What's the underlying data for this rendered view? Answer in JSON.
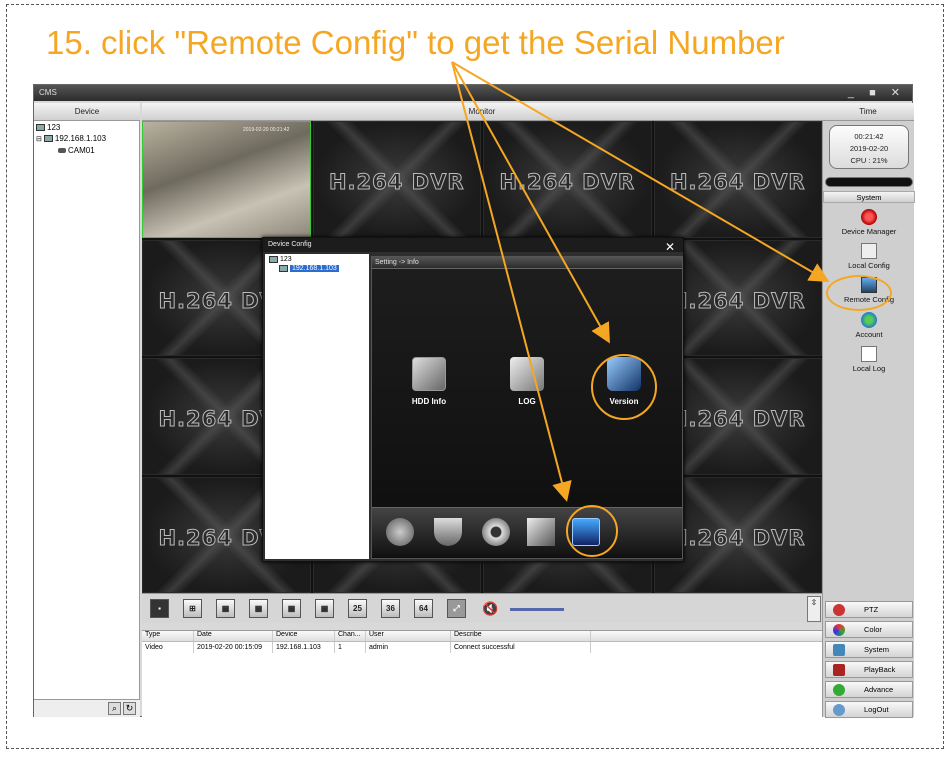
{
  "instruction": "15. click \"Remote Config\" to get the Serial Number",
  "window": {
    "title": "CMS",
    "controls": "_ ■ ✕"
  },
  "headers": {
    "device": "Device",
    "monitor": "Monitor",
    "time": "Time"
  },
  "tree": {
    "root": "123",
    "host": "192.168.1.103",
    "camera": "CAM01"
  },
  "clock": {
    "time": "00:21:42",
    "date": "2019-02-20",
    "cpu": "CPU : 21%"
  },
  "video_tile_label": "H.264 DVR",
  "live_timestamp": "2019-02-20 00:21:42",
  "system_panel": {
    "heading": "System",
    "items": [
      "Device Manager",
      "Local Config",
      "Remote Config",
      "Account",
      "Local Log"
    ]
  },
  "bottom_buttons": [
    "PTZ",
    "Color",
    "System",
    "PlayBack",
    "Advance",
    "LogOut"
  ],
  "toolbar": {
    "split_labels": [
      "25",
      "36",
      "64"
    ]
  },
  "log": {
    "columns": [
      "Type",
      "Date",
      "Device",
      "Chan...",
      "User",
      "Describe"
    ],
    "rows": [
      [
        "Video",
        "2019-02-20 00:15:09",
        "192.168.1.103",
        "1",
        "admin",
        "Connect successful"
      ]
    ]
  },
  "dialog": {
    "title": "Device Config",
    "close": "✕",
    "tree_root": "123",
    "tree_host": "192.168.1.103",
    "breadcrumb": "Setting -> Info",
    "icons": [
      "HDD Info",
      "LOG",
      "Version"
    ]
  },
  "colors": {
    "accent": "#f5a623",
    "selection": "#2a6dcc"
  }
}
